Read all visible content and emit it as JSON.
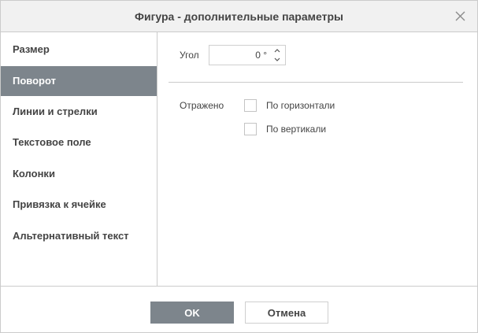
{
  "dialog": {
    "title": "Фигура - дополнительные параметры"
  },
  "sidebar": {
    "items": [
      {
        "label": "Размер",
        "active": false
      },
      {
        "label": "Поворот",
        "active": true
      },
      {
        "label": "Линии и стрелки",
        "active": false
      },
      {
        "label": "Текстовое поле",
        "active": false
      },
      {
        "label": "Колонки",
        "active": false
      },
      {
        "label": "Привязка к ячейке",
        "active": false
      },
      {
        "label": "Альтернативный текст",
        "active": false
      }
    ]
  },
  "rotation": {
    "angle_label": "Угол",
    "angle_value": "0 °",
    "flip_label": "Отражено",
    "horizontal_label": "По горизонтали",
    "horizontal_checked": false,
    "vertical_label": "По вертикали",
    "vertical_checked": false
  },
  "buttons": {
    "ok_label": "OK",
    "cancel_label": "Отмена"
  },
  "colors": {
    "accent": "#7d858c",
    "border": "#cbcbcb",
    "titlebar_bg": "#f1f1f1"
  },
  "icons": {
    "close": "close-icon",
    "spin_up": "chevron-up-icon",
    "spin_down": "chevron-down-icon"
  }
}
